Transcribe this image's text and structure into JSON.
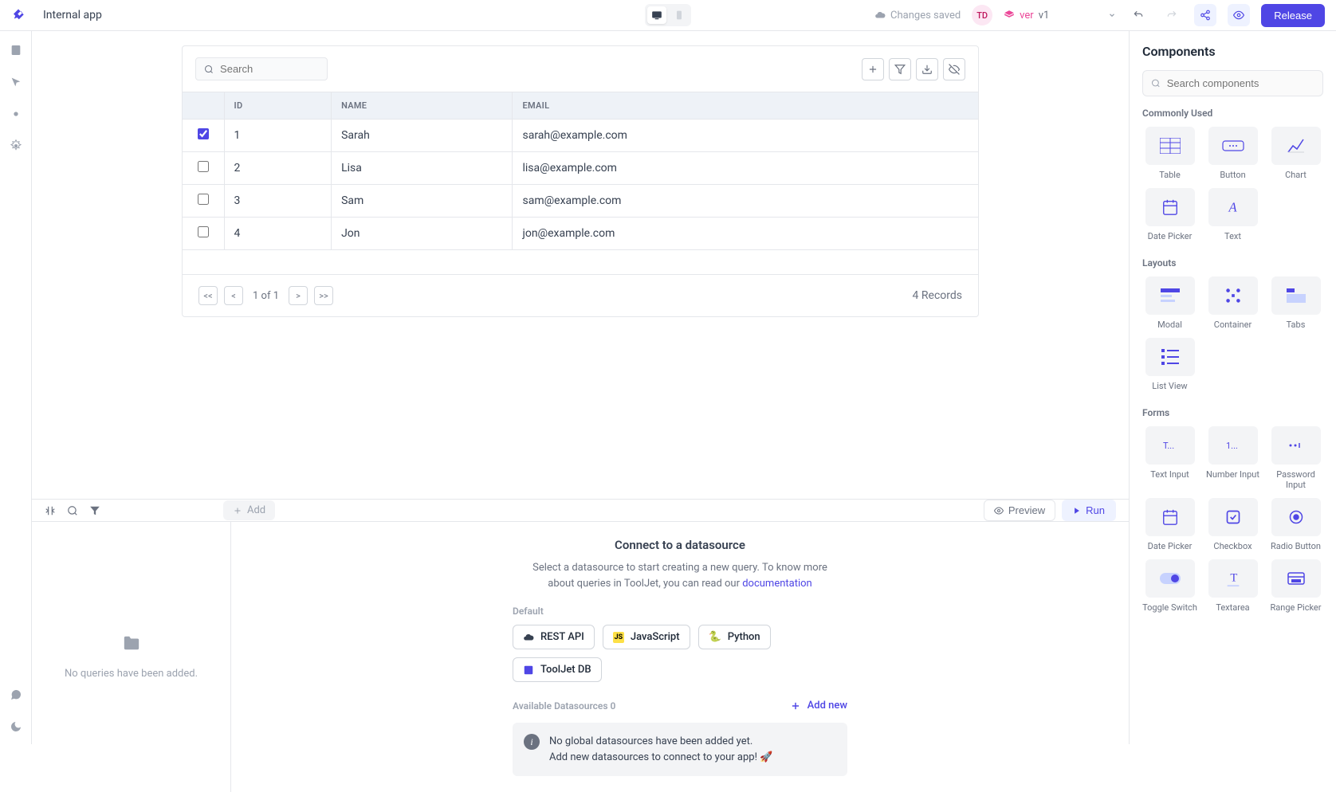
{
  "header": {
    "app_name": "Internal app",
    "changes_saved": "Changes saved",
    "avatar_initials": "TD",
    "version_label": "ver",
    "version_value": "v1",
    "release_label": "Release"
  },
  "table": {
    "search_placeholder": "Search",
    "columns": [
      "ID",
      "NAME",
      "EMAIL"
    ],
    "rows": [
      {
        "checked": true,
        "id": "1",
        "name": "Sarah",
        "email": "sarah@example.com"
      },
      {
        "checked": false,
        "id": "2",
        "name": "Lisa",
        "email": "lisa@example.com"
      },
      {
        "checked": false,
        "id": "3",
        "name": "Sam",
        "email": "sam@example.com"
      },
      {
        "checked": false,
        "id": "4",
        "name": "Jon",
        "email": "jon@example.com"
      }
    ],
    "pager": {
      "first": "<<",
      "prev": "<",
      "info": "1 of 1",
      "next": ">",
      "last": ">>"
    },
    "records": "4 Records"
  },
  "query": {
    "add_label": "Add",
    "preview_label": "Preview",
    "run_label": "Run",
    "empty_left": "No queries have been added.",
    "title": "Connect to a datasource",
    "desc_prefix": "Select a datasource to start creating a new query. To know more about queries in ToolJet, you can read our ",
    "doc_link": "documentation",
    "default_label": "Default",
    "chips": [
      {
        "name": "REST API",
        "icon": "cloud",
        "bg": "#374151",
        "fg": "#fff"
      },
      {
        "name": "JavaScript",
        "icon": "JS",
        "bg": "#fde047",
        "fg": "#000"
      },
      {
        "name": "Python",
        "icon": "py",
        "bg": "#fff",
        "fg": "#3776ab"
      },
      {
        "name": "ToolJet DB",
        "icon": "db",
        "bg": "#eef2ff",
        "fg": "#4f46e5"
      }
    ],
    "available_label": "Available Datasources 0",
    "add_new_label": "Add new",
    "info_line1": "No global datasources have been added yet.",
    "info_line2": "Add new datasources to connect to your app! 🚀"
  },
  "sidebar": {
    "title": "Components",
    "search_placeholder": "Search components",
    "sections": [
      {
        "label": "Commonly Used",
        "items": [
          {
            "name": "Table",
            "icon": "table"
          },
          {
            "name": "Button",
            "icon": "button"
          },
          {
            "name": "Chart",
            "icon": "chart"
          },
          {
            "name": "Date Picker",
            "icon": "calendar"
          },
          {
            "name": "Text",
            "icon": "text"
          }
        ]
      },
      {
        "label": "Layouts",
        "items": [
          {
            "name": "Modal",
            "icon": "modal"
          },
          {
            "name": "Container",
            "icon": "container"
          },
          {
            "name": "Tabs",
            "icon": "tabs"
          },
          {
            "name": "List View",
            "icon": "list"
          }
        ]
      },
      {
        "label": "Forms",
        "items": [
          {
            "name": "Text Input",
            "icon": "text-input"
          },
          {
            "name": "Number Input",
            "icon": "number-input"
          },
          {
            "name": "Password Input",
            "icon": "password-input"
          },
          {
            "name": "Date Picker",
            "icon": "calendar"
          },
          {
            "name": "Checkbox",
            "icon": "checkbox"
          },
          {
            "name": "Radio Button",
            "icon": "radio"
          },
          {
            "name": "Toggle Switch",
            "icon": "toggle"
          },
          {
            "name": "Textarea",
            "icon": "textarea"
          },
          {
            "name": "Range Picker",
            "icon": "range"
          }
        ]
      }
    ]
  }
}
